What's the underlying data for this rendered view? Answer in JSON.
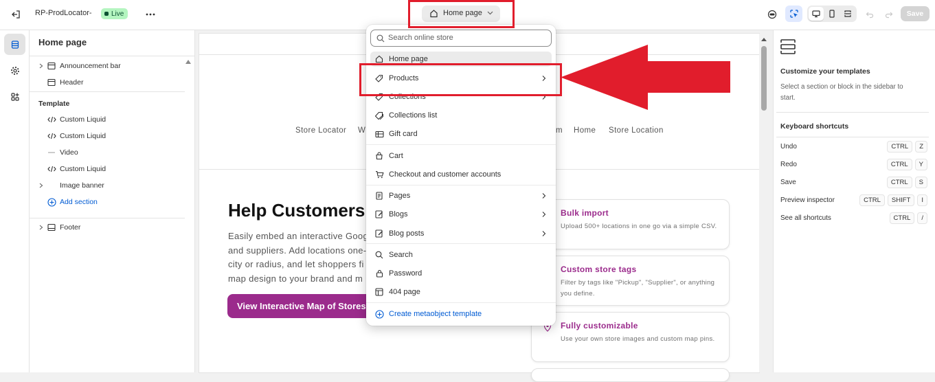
{
  "topbar": {
    "store_name": "RP-ProdLocator-",
    "live_badge": "Live",
    "page_selector": "Home page",
    "save_label": "Save"
  },
  "sidebar": {
    "title": "Home page",
    "header_sections": [
      {
        "label": "Announcement bar",
        "icon": "layout-section-icon",
        "expandable": true
      },
      {
        "label": "Header",
        "icon": "layout-section-icon",
        "expandable": false
      }
    ],
    "template_heading": "Template",
    "template_sections": [
      {
        "label": "Custom Liquid",
        "icon": "code-icon",
        "expandable": false
      },
      {
        "label": "Custom Liquid",
        "icon": "code-icon",
        "expandable": false
      },
      {
        "label": "Video",
        "icon": "video-icon",
        "expandable": false
      },
      {
        "label": "Custom Liquid",
        "icon": "code-icon",
        "expandable": false
      },
      {
        "label": "Image banner",
        "icon": "image-icon",
        "expandable": true
      }
    ],
    "add_section": "Add section",
    "footer": "Footer"
  },
  "preview": {
    "nav_items": [
      "Store Locator",
      "Wh",
      "m",
      "Home",
      "Store Location"
    ],
    "hero_title": "Help Customers",
    "hero_lines": [
      "Easily embed an interactive Goog",
      "and suppliers. Add locations one-",
      "city or radius, and let shoppers fi",
      "map design to your brand and m"
    ],
    "cta": "View Interactive Map of Stores",
    "cards": [
      {
        "title": "Bulk import",
        "text": "Upload 500+ locations in one go via a simple CSV."
      },
      {
        "title": "Custom store tags",
        "text": "Filter by tags like \"Pickup\", \"Supplier\", or anything you define."
      },
      {
        "title": "Fully customizable",
        "text": "Use your own store images and custom map pins."
      }
    ]
  },
  "dropdown": {
    "search_placeholder": "Search online store",
    "items": [
      {
        "label": "Home page",
        "icon": "home-icon",
        "submenu": false,
        "selected": true
      },
      {
        "label": "Products",
        "icon": "tag-icon",
        "submenu": true
      },
      {
        "label": "Collections",
        "icon": "tag-icon",
        "submenu": true
      },
      {
        "label": "Collections list",
        "icon": "collections-icon",
        "submenu": false
      },
      {
        "label": "Gift card",
        "icon": "gift-card-icon",
        "submenu": false
      },
      {
        "label": "Cart",
        "icon": "cart-icon",
        "submenu": false
      },
      {
        "label": "Checkout and customer accounts",
        "icon": "checkout-icon",
        "submenu": false
      },
      {
        "label": "Pages",
        "icon": "page-icon",
        "submenu": true
      },
      {
        "label": "Blogs",
        "icon": "blog-icon",
        "submenu": true
      },
      {
        "label": "Blog posts",
        "icon": "blog-post-icon",
        "submenu": true
      },
      {
        "label": "Search",
        "icon": "search-icon",
        "submenu": false
      },
      {
        "label": "Password",
        "icon": "lock-icon",
        "submenu": false
      },
      {
        "label": "404 page",
        "icon": "404-icon",
        "submenu": false
      }
    ],
    "create_label": "Create metaobject template"
  },
  "right_panel": {
    "title": "Customize your templates",
    "subtitle": "Select a section or block in the sidebar to start.",
    "shortcuts_title": "Keyboard shortcuts",
    "shortcuts": [
      {
        "label": "Undo",
        "keys": [
          "CTRL",
          "Z"
        ]
      },
      {
        "label": "Redo",
        "keys": [
          "CTRL",
          "Y"
        ]
      },
      {
        "label": "Save",
        "keys": [
          "CTRL",
          "S"
        ]
      },
      {
        "label": "Preview inspector",
        "keys": [
          "CTRL",
          "SHIFT",
          "I"
        ]
      },
      {
        "label": "See all shortcuts",
        "keys": [
          "CTRL",
          "/"
        ]
      }
    ]
  },
  "colors": {
    "accent": "#9b2b8c",
    "live_badge_bg": "#b4f5c0",
    "annotation_red": "#e11d2c",
    "link_blue": "#005bd3"
  }
}
